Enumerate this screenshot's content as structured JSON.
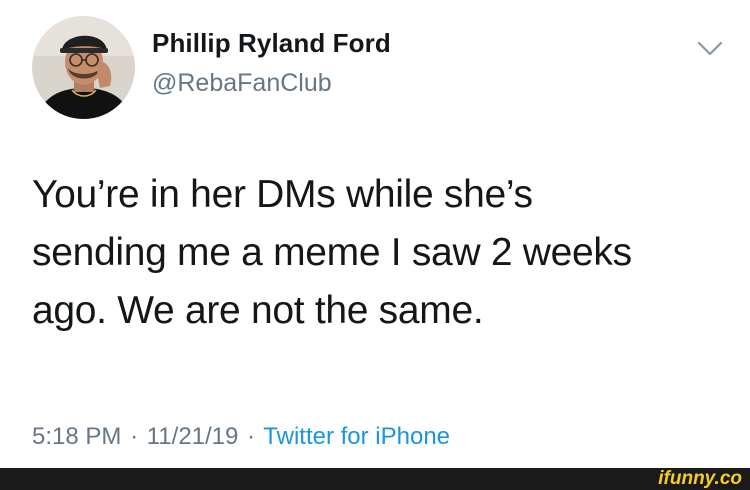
{
  "tweet": {
    "author": {
      "display_name": "Phillip Ryland Ford",
      "handle": "@RebaFanClub",
      "avatar_icon": "user-avatar-photo"
    },
    "menu_icon": "chevron-down-icon",
    "text": "You’re in her DMs while she’s\nsending me a meme I saw 2 weeks\nago. We are not the same.",
    "meta": {
      "time": "5:18 PM",
      "separator": "·",
      "date": "11/21/19",
      "client": "Twitter for iPhone"
    }
  },
  "footer": {
    "watermark": "ifunny.co"
  },
  "colors": {
    "text": "#14171a",
    "secondary": "#657786",
    "link": "#1b95e0",
    "footer_bg": "#1a1a1a",
    "watermark": "#f9cd1b"
  }
}
